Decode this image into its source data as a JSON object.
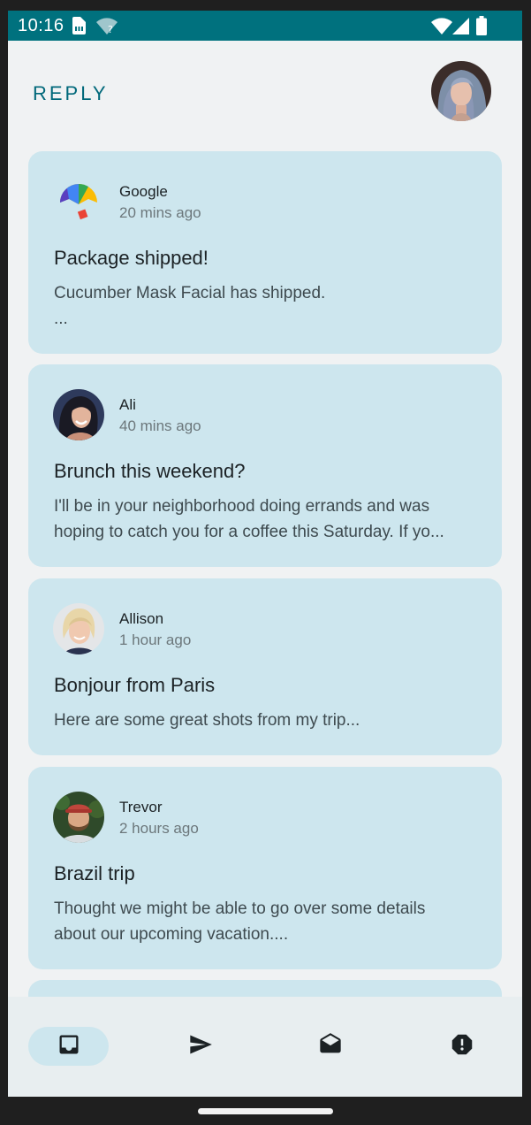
{
  "status_bar": {
    "time": "10:16",
    "icons": [
      "sim-card-icon",
      "wifi-question-icon",
      "wifi-icon",
      "cell-signal-icon",
      "battery-icon"
    ],
    "background": "#00717e"
  },
  "app_bar": {
    "title": "REPLY",
    "title_color": "#00687a"
  },
  "emails": [
    {
      "sender": "Google",
      "time": "20 mins ago",
      "subject": "Package shipped!",
      "preview": [
        "Cucumber Mask Facial has shipped.",
        "..."
      ],
      "avatar": "google-express-logo-icon"
    },
    {
      "sender": "Ali",
      "time": "40 mins ago",
      "subject": "Brunch this weekend?",
      "preview": [
        "I'll be in your neighborhood doing errands and was",
        "hoping to catch you for a coffee this Saturday. If yo..."
      ],
      "avatar": "ali-avatar"
    },
    {
      "sender": "Allison",
      "time": "1 hour ago",
      "subject": "Bonjour from Paris",
      "preview": [
        "Here are some great shots from my trip..."
      ],
      "avatar": "allison-avatar"
    },
    {
      "sender": "Trevor",
      "time": "2 hours ago",
      "subject": "Brazil trip",
      "preview": [
        "Thought we might be able to go over some details",
        "about our upcoming vacation...."
      ],
      "avatar": "trevor-avatar"
    }
  ],
  "bottom_nav": {
    "items": [
      {
        "icon": "inbox-icon",
        "active": true
      },
      {
        "icon": "send-icon",
        "active": false
      },
      {
        "icon": "drafts-icon",
        "active": false
      },
      {
        "icon": "spam-report-icon",
        "active": false
      }
    ],
    "active_color": "#cde6ee"
  },
  "colors": {
    "card_background": "#cde6ee",
    "page_background": "#f0f2f3",
    "icon_color": "#1b2124"
  }
}
